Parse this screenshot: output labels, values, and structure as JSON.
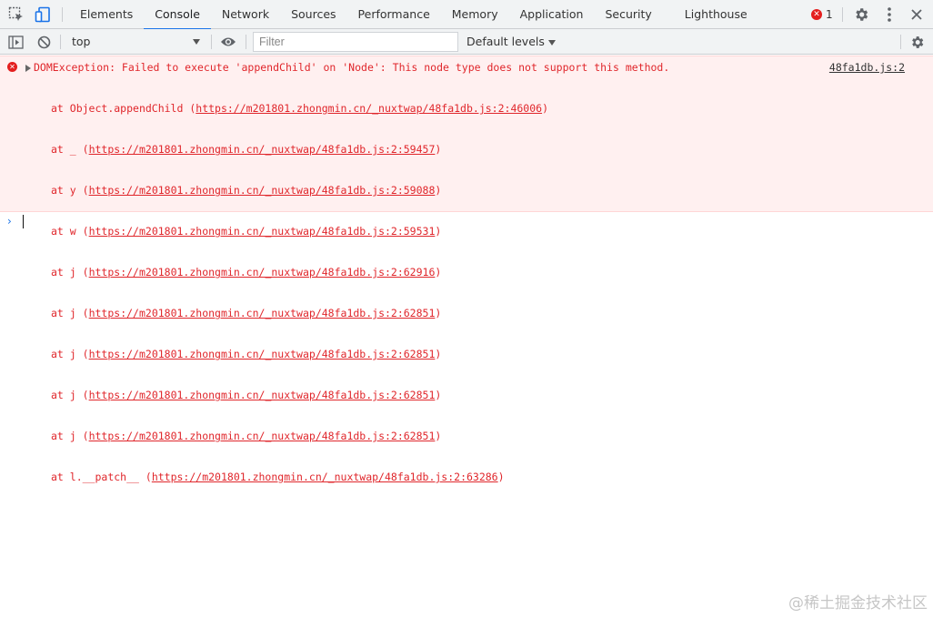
{
  "tabs": [
    {
      "label": "Elements"
    },
    {
      "label": "Console"
    },
    {
      "label": "Network"
    },
    {
      "label": "Sources"
    },
    {
      "label": "Performance"
    },
    {
      "label": "Memory"
    },
    {
      "label": "Application"
    },
    {
      "label": "Security"
    },
    {
      "label": "Lighthouse"
    }
  ],
  "active_tab": "Console",
  "status": {
    "error_count": "1",
    "error_icon": "error-circle-icon"
  },
  "toolbar": {
    "context": "top",
    "filter_placeholder": "Filter",
    "filter_value": "",
    "levels": "Default levels"
  },
  "icons": {
    "inspect": "inspect-element-icon",
    "device": "device-toolbar-icon",
    "sidebar": "show-sidebar-icon",
    "clear": "clear-console-icon",
    "eye": "live-expression-icon",
    "settings": "settings-gear-icon",
    "more": "more-vertical-icon",
    "close": "close-icon"
  },
  "colors": {
    "error_text": "#e0262b",
    "error_bg": "#fff0f0",
    "accent": "#1a73e8"
  },
  "console": {
    "error": {
      "message": "DOMException: Failed to execute 'appendChild' on 'Node': This node type does not support this method.",
      "source": "48fa1db.js:2",
      "stack": [
        {
          "fn": "Object.appendChild",
          "url": "https://m201801.zhongmin.cn/_nuxtwap/48fa1db.js:2:46006"
        },
        {
          "fn": "_",
          "url": "https://m201801.zhongmin.cn/_nuxtwap/48fa1db.js:2:59457"
        },
        {
          "fn": "y",
          "url": "https://m201801.zhongmin.cn/_nuxtwap/48fa1db.js:2:59088"
        },
        {
          "fn": "w",
          "url": "https://m201801.zhongmin.cn/_nuxtwap/48fa1db.js:2:59531"
        },
        {
          "fn": "j",
          "url": "https://m201801.zhongmin.cn/_nuxtwap/48fa1db.js:2:62916"
        },
        {
          "fn": "j",
          "url": "https://m201801.zhongmin.cn/_nuxtwap/48fa1db.js:2:62851"
        },
        {
          "fn": "j",
          "url": "https://m201801.zhongmin.cn/_nuxtwap/48fa1db.js:2:62851"
        },
        {
          "fn": "j",
          "url": "https://m201801.zhongmin.cn/_nuxtwap/48fa1db.js:2:62851"
        },
        {
          "fn": "j",
          "url": "https://m201801.zhongmin.cn/_nuxtwap/48fa1db.js:2:62851"
        },
        {
          "fn": "l.__patch__",
          "url": "https://m201801.zhongmin.cn/_nuxtwap/48fa1db.js:2:63286"
        }
      ]
    }
  },
  "watermark": "@稀土掘金技术社区"
}
